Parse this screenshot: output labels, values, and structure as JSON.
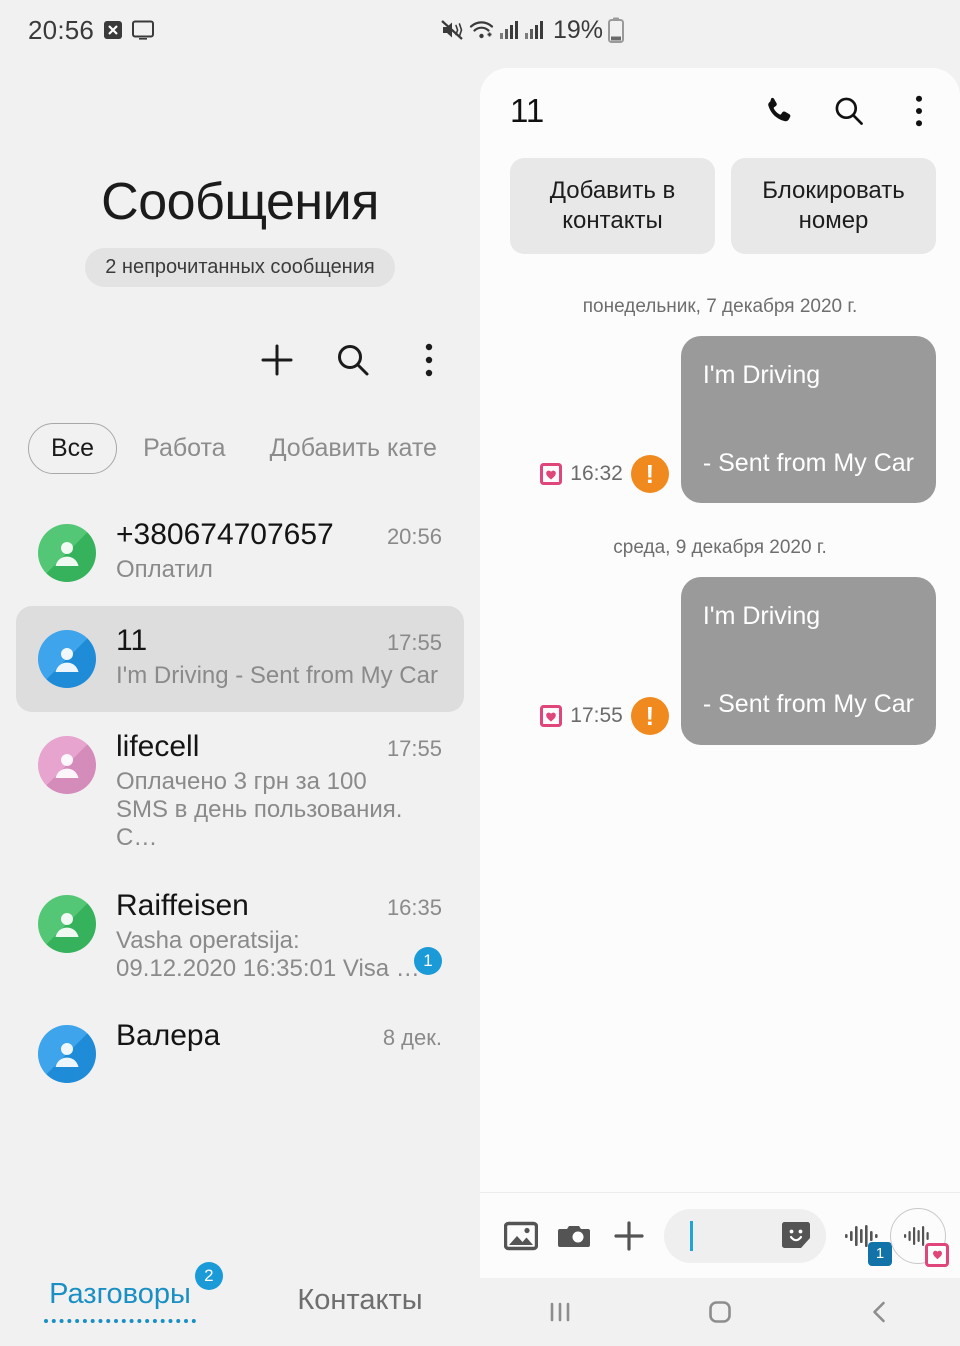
{
  "status_bar": {
    "clock": "20:56",
    "battery_percent": "19%",
    "icons": [
      "x-badge-icon",
      "monitor-icon",
      "mute-vibrate-icon",
      "wifi-icon",
      "signal-bars-icon",
      "signal-bars-2-icon",
      "battery-icon"
    ]
  },
  "messages_app": {
    "title": "Сообщения",
    "unread_pill": "2 непрочитанных сообщения",
    "toolbar": {
      "new_label": "plus-icon",
      "search_label": "search-icon",
      "more_label": "more-vertical-icon"
    },
    "chips": [
      {
        "label": "Все",
        "active": true
      },
      {
        "label": "Работа",
        "active": false
      },
      {
        "label": "Добавить кате",
        "active": false
      }
    ],
    "conversations": [
      {
        "name": "+380674707657",
        "time": "20:56",
        "snippet": "Оплатил",
        "avatar_color": "#3bbf63",
        "selected": false,
        "unread": ""
      },
      {
        "name": "11",
        "time": "17:55",
        "snippet": "I'm Driving  - Sent from My Car",
        "avatar_color": "#2196e8",
        "selected": true,
        "unread": ""
      },
      {
        "name": "lifecell",
        "time": "17:55",
        "snippet": "Оплачено 3 грн за 100\nSMS в день пользования. С…",
        "avatar_color": "#e496c8",
        "selected": false,
        "unread": ""
      },
      {
        "name": "Raiffeisen",
        "time": "16:35",
        "snippet": "Vasha operatsija:\n09.12.2020 16:35:01 Visa …",
        "avatar_color": "#3bbf63",
        "selected": false,
        "unread": "1"
      },
      {
        "name": "Валера",
        "time": "8 дек.",
        "snippet": "",
        "avatar_color": "#2196e8",
        "selected": false,
        "unread": ""
      }
    ],
    "tabs": [
      {
        "label": "Разговоры",
        "active": true,
        "badge": "2"
      },
      {
        "label": "Контакты",
        "active": false,
        "badge": ""
      }
    ]
  },
  "conversation": {
    "title": "11",
    "header_actions": [
      "call-icon",
      "search-icon",
      "more-vertical-icon"
    ],
    "quick_actions": [
      {
        "label": "Добавить в контакты"
      },
      {
        "label": "Блокировать номер"
      }
    ],
    "groups": [
      {
        "date": "понедельник, 7 декабря 2020 г.",
        "messages": [
          {
            "text": "I'm Driving\n\n- Sent from My Car",
            "time": "16:32",
            "failed": true,
            "sim_icon": "sim-heart-icon"
          }
        ]
      },
      {
        "date": "среда, 9 декабря 2020 г.",
        "messages": [
          {
            "text": "I'm Driving\n\n- Sent from My Car",
            "time": "17:55",
            "failed": true,
            "sim_icon": "sim-heart-icon"
          }
        ]
      }
    ],
    "compose": {
      "input_value": "",
      "buttons": [
        "gallery-icon",
        "camera-icon",
        "plus-icon",
        "sticker-icon",
        "voice-waveform-icon",
        "voice-waveform-send-icon"
      ],
      "sim_slot_badge": "1"
    }
  },
  "nav_bar": {
    "recents": "recents-icon",
    "home": "home-icon",
    "back": "back-icon"
  },
  "colors": {
    "accent_blue": "#1a9ad7",
    "warning_orange": "#f08a1e",
    "bubble_gray": "#9a9a9a",
    "sim_pink": "#e0457b"
  }
}
